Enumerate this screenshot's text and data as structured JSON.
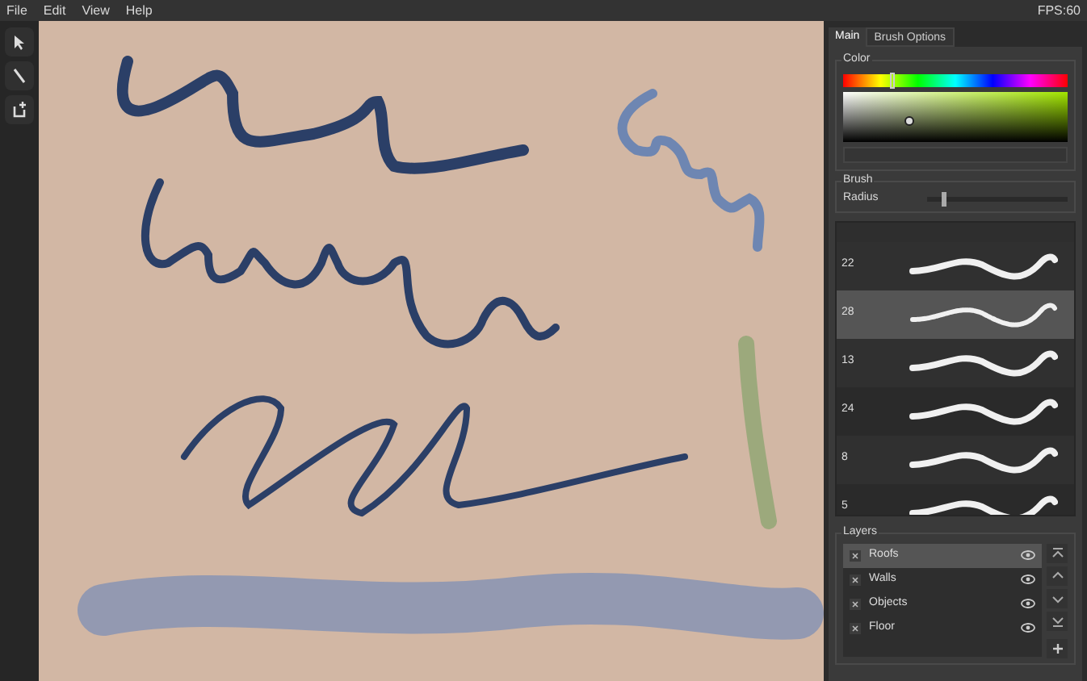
{
  "menu": [
    "File",
    "Edit",
    "View",
    "Help"
  ],
  "fps": "FPS:60",
  "tools": [
    {
      "kind": "pointer",
      "selected": false
    },
    {
      "kind": "line",
      "selected": false
    },
    {
      "kind": "add",
      "selected": false
    }
  ],
  "tabs": [
    {
      "label": "Main",
      "selected": true
    },
    {
      "label": "Brush Options",
      "selected": false
    }
  ],
  "color": {
    "title": "Color",
    "hue": {
      "level": 0.21
    }
  },
  "brush": {
    "title": "Brush",
    "radius": {
      "label": "Radius",
      "level": 0.1
    }
  },
  "brushes": [
    {
      "label": "22",
      "selected": false
    },
    {
      "label": "28",
      "selected": true
    },
    {
      "label": "13",
      "selected": false
    },
    {
      "label": "24",
      "selected": false
    },
    {
      "label": "8",
      "selected": false
    },
    {
      "label": "5",
      "selected": false
    }
  ],
  "layers": {
    "title": "Layers",
    "items": [
      {
        "name": "Roofs",
        "selected": true
      },
      {
        "name": "Walls",
        "selected": false
      },
      {
        "name": "Objects",
        "selected": false
      },
      {
        "name": "Floor",
        "selected": false
      }
    ],
    "buttons": [
      {
        "kind": "top"
      },
      {
        "kind": "up"
      },
      {
        "kind": "down"
      },
      {
        "kind": "bottom"
      },
      {
        "kind": "add"
      }
    ]
  }
}
